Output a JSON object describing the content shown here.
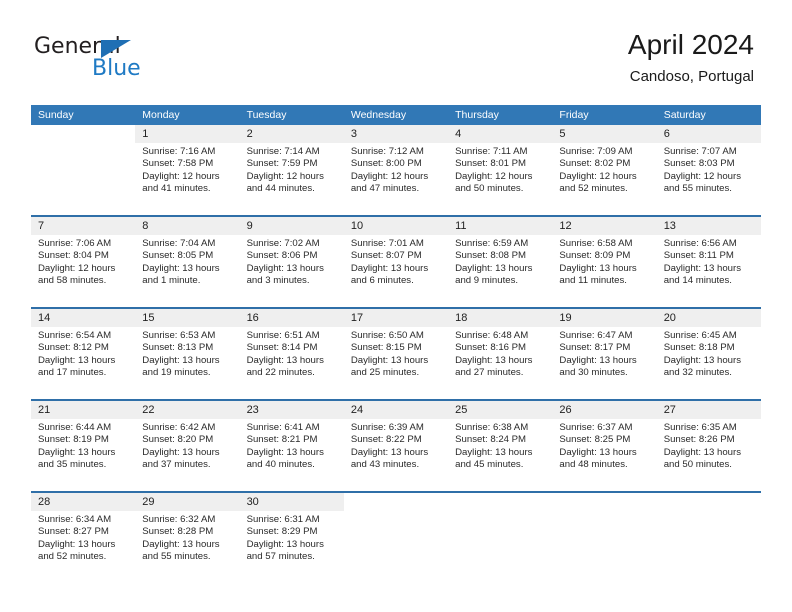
{
  "brand": {
    "name_top": "General",
    "name_bottom": "Blue",
    "triangle_icon": "triangle-icon",
    "color_dark": "#231f20",
    "color_blue": "#1f7ac4"
  },
  "header": {
    "title": "April 2024",
    "subtitle": "Candoso, Portugal"
  },
  "theme": {
    "header_blue": "#3178b6",
    "separator_blue": "#2f6fa8",
    "day_number_band": "#efefef"
  },
  "weekdays": [
    "Sunday",
    "Monday",
    "Tuesday",
    "Wednesday",
    "Thursday",
    "Friday",
    "Saturday"
  ],
  "weeks": [
    [
      {
        "day": "",
        "sunrise": "",
        "sunset": "",
        "daylight_line1": "",
        "daylight_line2": "",
        "blank": true
      },
      {
        "day": "1",
        "sunrise": "Sunrise: 7:16 AM",
        "sunset": "Sunset: 7:58 PM",
        "daylight_line1": "Daylight: 12 hours",
        "daylight_line2": "and 41 minutes."
      },
      {
        "day": "2",
        "sunrise": "Sunrise: 7:14 AM",
        "sunset": "Sunset: 7:59 PM",
        "daylight_line1": "Daylight: 12 hours",
        "daylight_line2": "and 44 minutes."
      },
      {
        "day": "3",
        "sunrise": "Sunrise: 7:12 AM",
        "sunset": "Sunset: 8:00 PM",
        "daylight_line1": "Daylight: 12 hours",
        "daylight_line2": "and 47 minutes."
      },
      {
        "day": "4",
        "sunrise": "Sunrise: 7:11 AM",
        "sunset": "Sunset: 8:01 PM",
        "daylight_line1": "Daylight: 12 hours",
        "daylight_line2": "and 50 minutes."
      },
      {
        "day": "5",
        "sunrise": "Sunrise: 7:09 AM",
        "sunset": "Sunset: 8:02 PM",
        "daylight_line1": "Daylight: 12 hours",
        "daylight_line2": "and 52 minutes."
      },
      {
        "day": "6",
        "sunrise": "Sunrise: 7:07 AM",
        "sunset": "Sunset: 8:03 PM",
        "daylight_line1": "Daylight: 12 hours",
        "daylight_line2": "and 55 minutes."
      }
    ],
    [
      {
        "day": "7",
        "sunrise": "Sunrise: 7:06 AM",
        "sunset": "Sunset: 8:04 PM",
        "daylight_line1": "Daylight: 12 hours",
        "daylight_line2": "and 58 minutes."
      },
      {
        "day": "8",
        "sunrise": "Sunrise: 7:04 AM",
        "sunset": "Sunset: 8:05 PM",
        "daylight_line1": "Daylight: 13 hours",
        "daylight_line2": "and 1 minute."
      },
      {
        "day": "9",
        "sunrise": "Sunrise: 7:02 AM",
        "sunset": "Sunset: 8:06 PM",
        "daylight_line1": "Daylight: 13 hours",
        "daylight_line2": "and 3 minutes."
      },
      {
        "day": "10",
        "sunrise": "Sunrise: 7:01 AM",
        "sunset": "Sunset: 8:07 PM",
        "daylight_line1": "Daylight: 13 hours",
        "daylight_line2": "and 6 minutes."
      },
      {
        "day": "11",
        "sunrise": "Sunrise: 6:59 AM",
        "sunset": "Sunset: 8:08 PM",
        "daylight_line1": "Daylight: 13 hours",
        "daylight_line2": "and 9 minutes."
      },
      {
        "day": "12",
        "sunrise": "Sunrise: 6:58 AM",
        "sunset": "Sunset: 8:09 PM",
        "daylight_line1": "Daylight: 13 hours",
        "daylight_line2": "and 11 minutes."
      },
      {
        "day": "13",
        "sunrise": "Sunrise: 6:56 AM",
        "sunset": "Sunset: 8:11 PM",
        "daylight_line1": "Daylight: 13 hours",
        "daylight_line2": "and 14 minutes."
      }
    ],
    [
      {
        "day": "14",
        "sunrise": "Sunrise: 6:54 AM",
        "sunset": "Sunset: 8:12 PM",
        "daylight_line1": "Daylight: 13 hours",
        "daylight_line2": "and 17 minutes."
      },
      {
        "day": "15",
        "sunrise": "Sunrise: 6:53 AM",
        "sunset": "Sunset: 8:13 PM",
        "daylight_line1": "Daylight: 13 hours",
        "daylight_line2": "and 19 minutes."
      },
      {
        "day": "16",
        "sunrise": "Sunrise: 6:51 AM",
        "sunset": "Sunset: 8:14 PM",
        "daylight_line1": "Daylight: 13 hours",
        "daylight_line2": "and 22 minutes."
      },
      {
        "day": "17",
        "sunrise": "Sunrise: 6:50 AM",
        "sunset": "Sunset: 8:15 PM",
        "daylight_line1": "Daylight: 13 hours",
        "daylight_line2": "and 25 minutes."
      },
      {
        "day": "18",
        "sunrise": "Sunrise: 6:48 AM",
        "sunset": "Sunset: 8:16 PM",
        "daylight_line1": "Daylight: 13 hours",
        "daylight_line2": "and 27 minutes."
      },
      {
        "day": "19",
        "sunrise": "Sunrise: 6:47 AM",
        "sunset": "Sunset: 8:17 PM",
        "daylight_line1": "Daylight: 13 hours",
        "daylight_line2": "and 30 minutes."
      },
      {
        "day": "20",
        "sunrise": "Sunrise: 6:45 AM",
        "sunset": "Sunset: 8:18 PM",
        "daylight_line1": "Daylight: 13 hours",
        "daylight_line2": "and 32 minutes."
      }
    ],
    [
      {
        "day": "21",
        "sunrise": "Sunrise: 6:44 AM",
        "sunset": "Sunset: 8:19 PM",
        "daylight_line1": "Daylight: 13 hours",
        "daylight_line2": "and 35 minutes."
      },
      {
        "day": "22",
        "sunrise": "Sunrise: 6:42 AM",
        "sunset": "Sunset: 8:20 PM",
        "daylight_line1": "Daylight: 13 hours",
        "daylight_line2": "and 37 minutes."
      },
      {
        "day": "23",
        "sunrise": "Sunrise: 6:41 AM",
        "sunset": "Sunset: 8:21 PM",
        "daylight_line1": "Daylight: 13 hours",
        "daylight_line2": "and 40 minutes."
      },
      {
        "day": "24",
        "sunrise": "Sunrise: 6:39 AM",
        "sunset": "Sunset: 8:22 PM",
        "daylight_line1": "Daylight: 13 hours",
        "daylight_line2": "and 43 minutes."
      },
      {
        "day": "25",
        "sunrise": "Sunrise: 6:38 AM",
        "sunset": "Sunset: 8:24 PM",
        "daylight_line1": "Daylight: 13 hours",
        "daylight_line2": "and 45 minutes."
      },
      {
        "day": "26",
        "sunrise": "Sunrise: 6:37 AM",
        "sunset": "Sunset: 8:25 PM",
        "daylight_line1": "Daylight: 13 hours",
        "daylight_line2": "and 48 minutes."
      },
      {
        "day": "27",
        "sunrise": "Sunrise: 6:35 AM",
        "sunset": "Sunset: 8:26 PM",
        "daylight_line1": "Daylight: 13 hours",
        "daylight_line2": "and 50 minutes."
      }
    ],
    [
      {
        "day": "28",
        "sunrise": "Sunrise: 6:34 AM",
        "sunset": "Sunset: 8:27 PM",
        "daylight_line1": "Daylight: 13 hours",
        "daylight_line2": "and 52 minutes."
      },
      {
        "day": "29",
        "sunrise": "Sunrise: 6:32 AM",
        "sunset": "Sunset: 8:28 PM",
        "daylight_line1": "Daylight: 13 hours",
        "daylight_line2": "and 55 minutes."
      },
      {
        "day": "30",
        "sunrise": "Sunrise: 6:31 AM",
        "sunset": "Sunset: 8:29 PM",
        "daylight_line1": "Daylight: 13 hours",
        "daylight_line2": "and 57 minutes."
      },
      {
        "day": "",
        "sunrise": "",
        "sunset": "",
        "daylight_line1": "",
        "daylight_line2": "",
        "blank": true
      },
      {
        "day": "",
        "sunrise": "",
        "sunset": "",
        "daylight_line1": "",
        "daylight_line2": "",
        "blank": true
      },
      {
        "day": "",
        "sunrise": "",
        "sunset": "",
        "daylight_line1": "",
        "daylight_line2": "",
        "blank": true
      },
      {
        "day": "",
        "sunrise": "",
        "sunset": "",
        "daylight_line1": "",
        "daylight_line2": "",
        "blank": true
      }
    ]
  ]
}
